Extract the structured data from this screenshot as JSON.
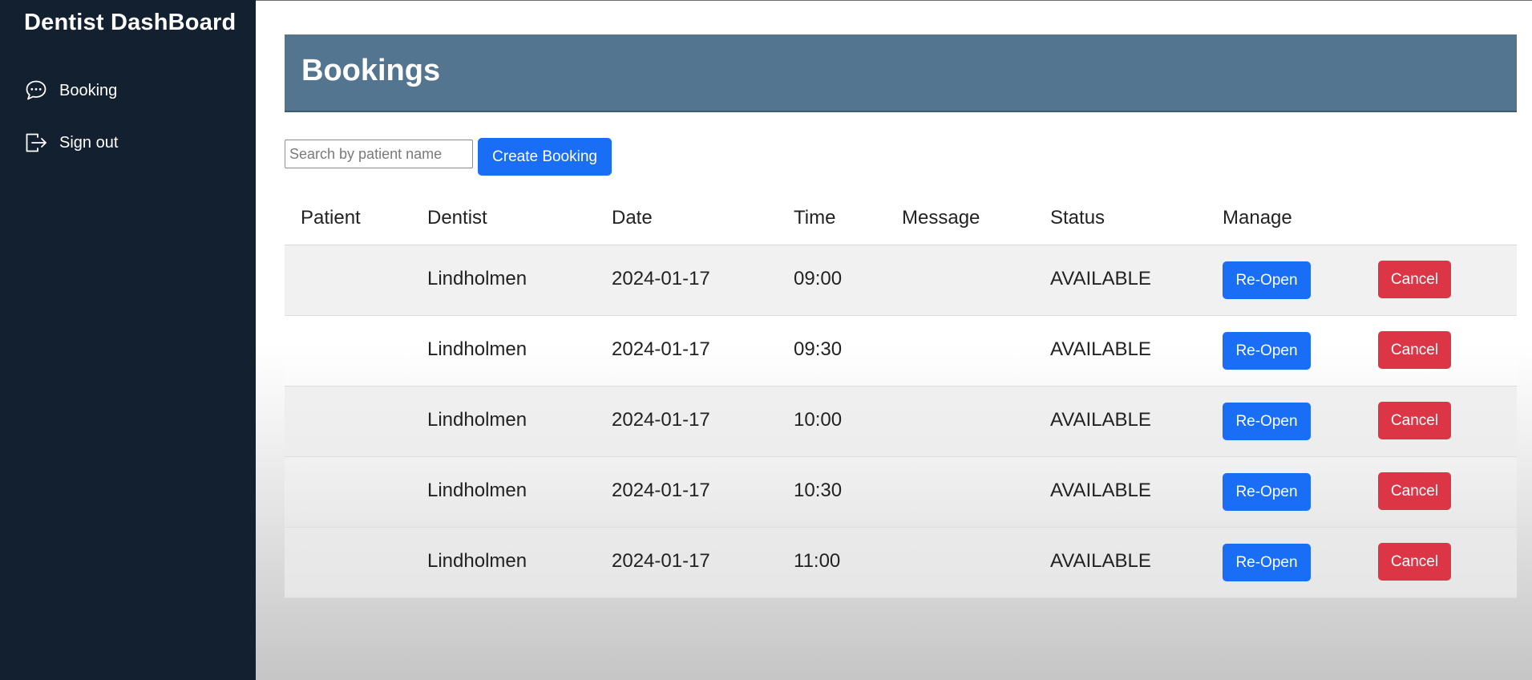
{
  "sidebar": {
    "brand": "Dentist DashBoard",
    "items": [
      {
        "label": "Booking",
        "icon": "chat-bubble-icon"
      },
      {
        "label": "Sign out",
        "icon": "sign-out-icon"
      }
    ]
  },
  "main": {
    "title": "Bookings",
    "search": {
      "placeholder": "Search by patient name",
      "value": ""
    },
    "create_label": "Create Booking",
    "columns": [
      "Patient",
      "Dentist",
      "Date",
      "Time",
      "Message",
      "Status",
      "Manage"
    ],
    "rows": [
      {
        "patient": "",
        "dentist": "Lindholmen",
        "date": "2024-01-17",
        "time": "09:00",
        "message": "",
        "status": "AVAILABLE",
        "reopen": "Re-Open",
        "cancel": "Cancel"
      },
      {
        "patient": "",
        "dentist": "Lindholmen",
        "date": "2024-01-17",
        "time": "09:30",
        "message": "",
        "status": "AVAILABLE",
        "reopen": "Re-Open",
        "cancel": "Cancel"
      },
      {
        "patient": "",
        "dentist": "Lindholmen",
        "date": "2024-01-17",
        "time": "10:00",
        "message": "",
        "status": "AVAILABLE",
        "reopen": "Re-Open",
        "cancel": "Cancel"
      },
      {
        "patient": "",
        "dentist": "Lindholmen",
        "date": "2024-01-17",
        "time": "10:30",
        "message": "",
        "status": "AVAILABLE",
        "reopen": "Re-Open",
        "cancel": "Cancel"
      },
      {
        "patient": "",
        "dentist": "Lindholmen",
        "date": "2024-01-17",
        "time": "11:00",
        "message": "",
        "status": "AVAILABLE",
        "reopen": "Re-Open",
        "cancel": "Cancel"
      }
    ]
  },
  "colors": {
    "sidebar_bg": "#13202f",
    "header_bar": "#547590",
    "primary": "#1a6ef5",
    "danger": "#dc3646"
  }
}
